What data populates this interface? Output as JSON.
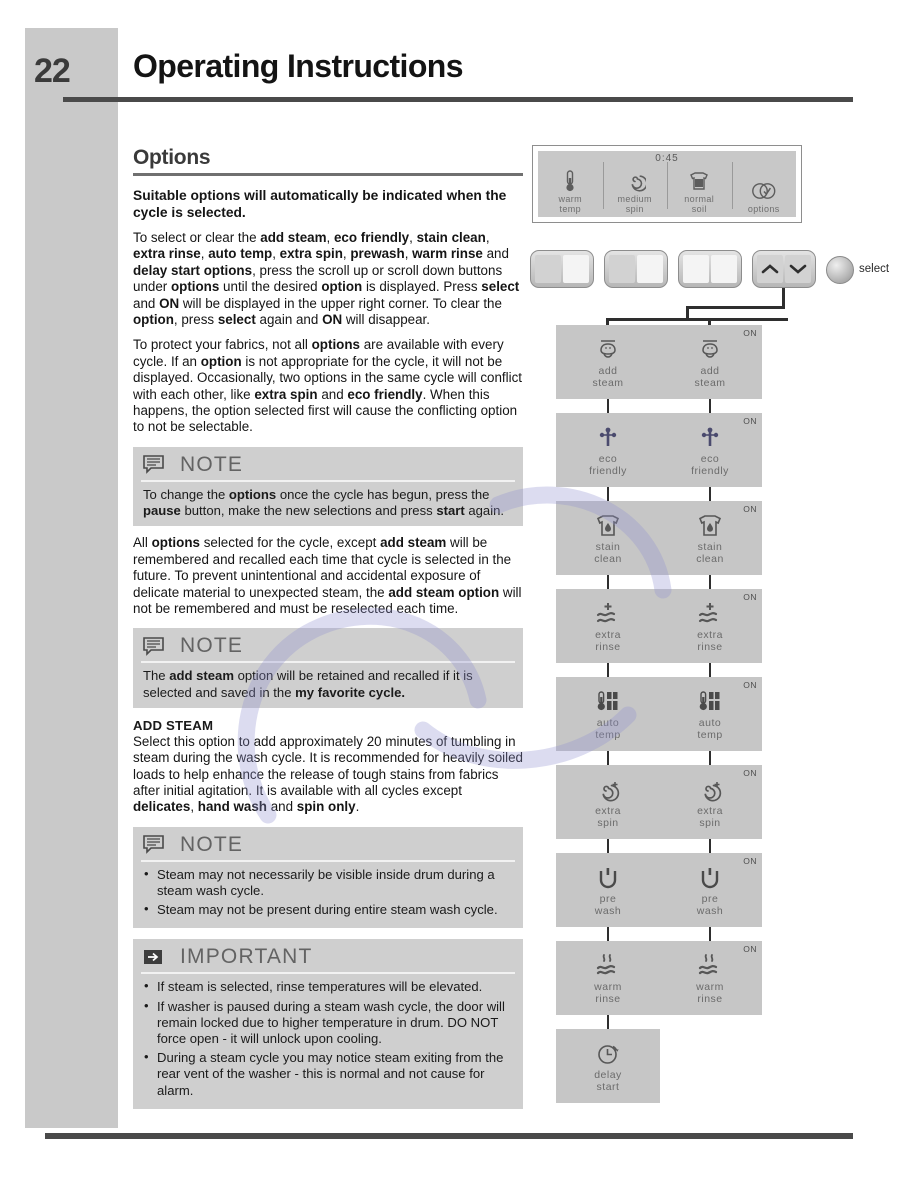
{
  "page": {
    "number": "22",
    "title": "Operating Instructions"
  },
  "section": {
    "heading": "Options",
    "lead": "Suitable options will automatically be indicated when the cycle is selected.",
    "paragraph_1_parts": [
      {
        "t": "To select or clear the ",
        "b": false
      },
      {
        "t": "add steam",
        "b": true
      },
      {
        "t": ", ",
        "b": false
      },
      {
        "t": "eco friendly",
        "b": true
      },
      {
        "t": ", ",
        "b": false
      },
      {
        "t": "stain clean",
        "b": true
      },
      {
        "t": ", ",
        "b": false
      },
      {
        "t": "extra rinse",
        "b": true
      },
      {
        "t": ", ",
        "b": false
      },
      {
        "t": "auto temp",
        "b": true
      },
      {
        "t": ", ",
        "b": false
      },
      {
        "t": "extra spin",
        "b": true
      },
      {
        "t": ", ",
        "b": false
      },
      {
        "t": "prewash",
        "b": true
      },
      {
        "t": ", ",
        "b": false
      },
      {
        "t": "warm rinse",
        "b": true
      },
      {
        "t": " and ",
        "b": false
      },
      {
        "t": "delay start options",
        "b": true
      },
      {
        "t": ", press the scroll up or scroll down buttons under ",
        "b": false
      },
      {
        "t": "options",
        "b": true
      },
      {
        "t": " until the desired ",
        "b": false
      },
      {
        "t": "option",
        "b": true
      },
      {
        "t": " is displayed. Press ",
        "b": false
      },
      {
        "t": "select",
        "b": true
      },
      {
        "t": " and ",
        "b": false
      },
      {
        "t": "ON",
        "b": true
      },
      {
        "t": " will be displayed in the upper right corner. To clear the ",
        "b": false
      },
      {
        "t": "option",
        "b": true
      },
      {
        "t": ", press ",
        "b": false
      },
      {
        "t": "select",
        "b": true
      },
      {
        "t": " again and ",
        "b": false
      },
      {
        "t": "ON",
        "b": true
      },
      {
        "t": " will disappear.",
        "b": false
      }
    ],
    "paragraph_2_parts": [
      {
        "t": "To protect your fabrics, not all ",
        "b": false
      },
      {
        "t": "options",
        "b": true
      },
      {
        "t": " are available with every cycle. If an ",
        "b": false
      },
      {
        "t": "option",
        "b": true
      },
      {
        "t": " is not appropriate for the cycle, it will not be displayed. Occasionally, two options in the same cycle will conflict with each other, like ",
        "b": false
      },
      {
        "t": "extra spin",
        "b": true
      },
      {
        "t": " and ",
        "b": false
      },
      {
        "t": "eco friendly",
        "b": true
      },
      {
        "t": ". When this happens, the option selected first will cause the conflicting option to not be selectable.",
        "b": false
      }
    ],
    "paragraph_3_parts": [
      {
        "t": "All ",
        "b": false
      },
      {
        "t": "options",
        "b": true
      },
      {
        "t": " selected for the cycle, except ",
        "b": false
      },
      {
        "t": "add steam",
        "b": true
      },
      {
        "t": " will be remembered and recalled each time that cycle is selected in the future. To prevent unintentional and accidental exposure of delicate material to unexpected steam, the ",
        "b": false
      },
      {
        "t": "add steam option",
        "b": true
      },
      {
        "t": " will not be remembered and must be reselected each time.",
        "b": false
      }
    ],
    "add_steam_heading": "ADD STEAM",
    "add_steam_parts": [
      {
        "t": "Select this option to add approximately 20 minutes of tumbling in steam during the wash cycle. It is recommended for heavily soiled loads to help enhance the release of tough stains from fabrics after initial agitation. It is available with all cycles except ",
        "b": false
      },
      {
        "t": "delicates",
        "b": true
      },
      {
        "t": ", ",
        "b": false
      },
      {
        "t": "hand wash",
        "b": true
      },
      {
        "t": " and ",
        "b": false
      },
      {
        "t": "spin only",
        "b": true
      },
      {
        "t": ".",
        "b": false
      }
    ]
  },
  "callouts": [
    {
      "id": "note-1",
      "icon": "note-icon",
      "title": "NOTE",
      "body_parts": [
        {
          "t": "To change the ",
          "b": false
        },
        {
          "t": "options",
          "b": true
        },
        {
          "t": " once the cycle has begun, press the ",
          "b": false
        },
        {
          "t": "pause",
          "b": true
        },
        {
          "t": " button, make the new selections and press ",
          "b": false
        },
        {
          "t": "start",
          "b": true
        },
        {
          "t": " again.",
          "b": false
        }
      ]
    },
    {
      "id": "note-2",
      "icon": "note-icon",
      "title": "NOTE",
      "body_parts": [
        {
          "t": "The ",
          "b": false
        },
        {
          "t": "add steam",
          "b": true
        },
        {
          "t": " option will be retained and recalled if it is selected and saved in the ",
          "b": false
        },
        {
          "t": "my favorite cycle.",
          "b": true
        }
      ]
    },
    {
      "id": "note-3",
      "icon": "note-icon",
      "title": "NOTE",
      "bullets": [
        "Steam may not necessarily be visible inside drum during a steam wash cycle.",
        "Steam may not be present during entire steam wash cycle."
      ]
    },
    {
      "id": "important-1",
      "icon": "important-arrow-icon",
      "title": "IMPORTANT",
      "bullets": [
        "If steam is selected, rinse temperatures will be elevated.",
        "If washer is paused during a steam wash cycle, the door will remain locked due to higher temperature in drum. DO NOT force open - it will unlock upon cooling.",
        "During a steam cycle you may notice steam exiting from the rear vent of the washer - this is normal and not cause for alarm."
      ]
    }
  ],
  "diagram": {
    "display": {
      "time": "0:45",
      "cells": [
        {
          "icon": "thermometer-icon",
          "label_line_1": "warm",
          "label_line_2": "temp"
        },
        {
          "icon": "spiral-spin-icon",
          "label_line_1": "medium",
          "label_line_2": "spin"
        },
        {
          "icon": "soil-shirt-icon",
          "label_line_1": "normal",
          "label_line_2": "soil"
        },
        {
          "icon": "options-circles-icon",
          "label_line_1": "options",
          "label_line_2": ""
        }
      ]
    },
    "buttons": [
      {
        "name": "temp-rocker",
        "icon": "rocker-button"
      },
      {
        "name": "spin-rocker",
        "icon": "rocker-button"
      },
      {
        "name": "soil-rocker",
        "icon": "rocker-button"
      },
      {
        "name": "options-scroll-rocker",
        "icon": "scroll-up-down-rocker"
      }
    ],
    "select_label": "select",
    "on_tag": "ON",
    "options_left": [
      {
        "icon": "add-steam-icon",
        "line1": "add",
        "line2": "steam",
        "on": false
      },
      {
        "icon": "eco-friendly-icon",
        "line1": "eco",
        "line2": "friendly",
        "on": false
      },
      {
        "icon": "stain-clean-icon",
        "line1": "stain",
        "line2": "clean",
        "on": false
      },
      {
        "icon": "extra-rinse-icon",
        "line1": "extra",
        "line2": "rinse",
        "on": false
      },
      {
        "icon": "auto-temp-icon",
        "line1": "auto",
        "line2": "temp",
        "on": false
      },
      {
        "icon": "extra-spin-icon",
        "line1": "extra",
        "line2": "spin",
        "on": false
      },
      {
        "icon": "pre-wash-icon",
        "line1": "pre",
        "line2": "wash",
        "on": false
      },
      {
        "icon": "warm-rinse-icon",
        "line1": "warm",
        "line2": "rinse",
        "on": false
      },
      {
        "icon": "delay-start-icon",
        "line1": "delay",
        "line2": "start",
        "on": false
      }
    ],
    "options_right": [
      {
        "icon": "add-steam-icon",
        "line1": "add",
        "line2": "steam",
        "on": true
      },
      {
        "icon": "eco-friendly-icon",
        "line1": "eco",
        "line2": "friendly",
        "on": true
      },
      {
        "icon": "stain-clean-icon",
        "line1": "stain",
        "line2": "clean",
        "on": true
      },
      {
        "icon": "extra-rinse-icon",
        "line1": "extra",
        "line2": "rinse",
        "on": true
      },
      {
        "icon": "auto-temp-icon",
        "line1": "auto",
        "line2": "temp",
        "on": true
      },
      {
        "icon": "extra-spin-icon",
        "line1": "extra",
        "line2": "spin",
        "on": true
      },
      {
        "icon": "pre-wash-icon",
        "line1": "pre",
        "line2": "wash",
        "on": true
      },
      {
        "icon": "warm-rinse-icon",
        "line1": "warm",
        "line2": "rinse",
        "on": true
      }
    ]
  },
  "colors": {
    "sidebar_gray": "#c9c9c9",
    "callout_gray": "#cfcfcf",
    "cell_gray": "#c6c6c6",
    "rule_dark": "#4a4a4a",
    "label_gray": "#6b6b6b"
  }
}
